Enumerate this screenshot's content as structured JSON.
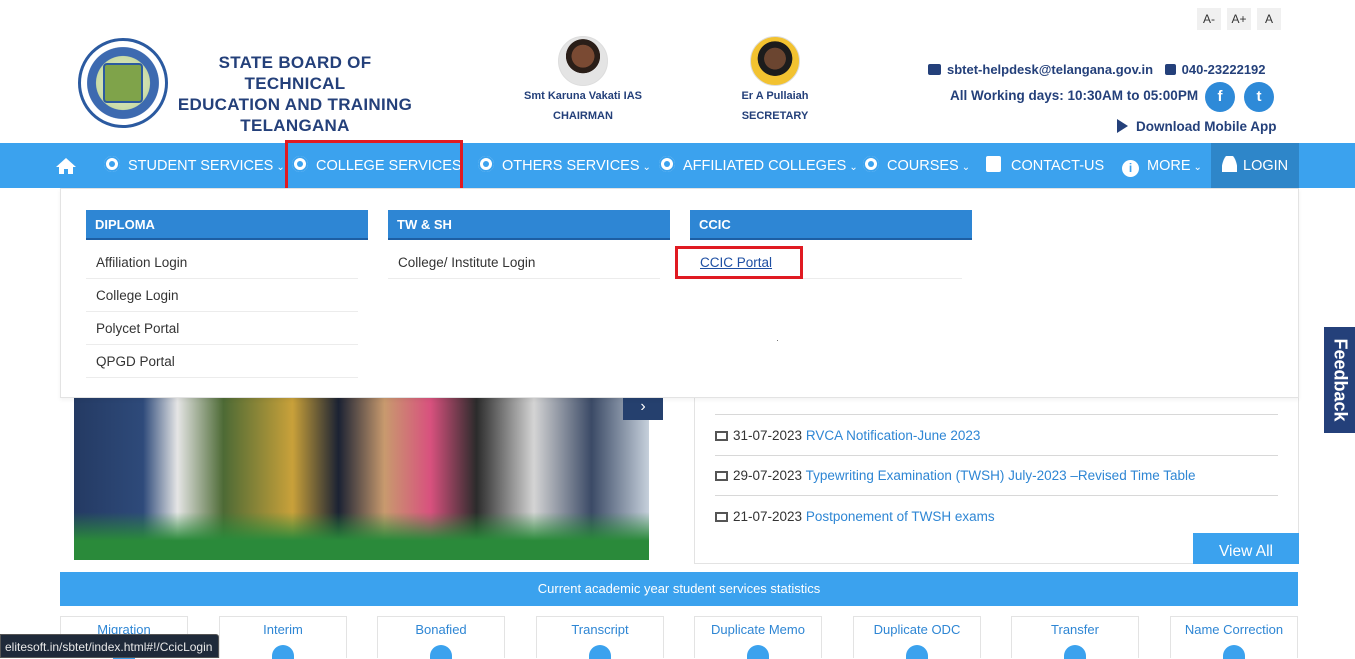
{
  "header": {
    "org_title_line1": "STATE BOARD OF TECHNICAL",
    "org_title_line2": "EDUCATION AND TRAINING",
    "org_title_line3": "TELANGANA",
    "people": [
      {
        "name": "Smt Karuna Vakati IAS",
        "role": "CHAIRMAN"
      },
      {
        "name": "Er A Pullaiah",
        "role": "SECRETARY"
      }
    ],
    "font_buttons": [
      "A-",
      "A+",
      "A"
    ],
    "email": "sbtet-helpdesk@telangana.gov.in",
    "phone": "040-23222192",
    "working_days": "All Working days: 10:30AM to 05:00PM",
    "social": [
      "f",
      "t"
    ],
    "download_app": "Download Mobile App"
  },
  "nav": {
    "items": [
      {
        "label": "STUDENT SERVICES",
        "icon": "gear-icon"
      },
      {
        "label": "COLLEGE SERVICES",
        "icon": "gear-icon"
      },
      {
        "label": "OTHERS SERVICES",
        "icon": "gear-icon"
      },
      {
        "label": "AFFILIATED COLLEGES",
        "icon": "gear-icon"
      },
      {
        "label": "COURSES",
        "icon": "gear-icon"
      },
      {
        "label": "CONTACT-US",
        "icon": "contact-icon"
      },
      {
        "label": "MORE",
        "icon": "info-icon"
      },
      {
        "label": "LOGIN",
        "icon": "user-icon"
      }
    ],
    "accent_color": "#3ba2ee"
  },
  "dropdown": {
    "columns": [
      {
        "title": "DIPLOMA",
        "links": [
          "Affiliation Login",
          "College Login",
          "Polycet Portal",
          "QPGD Portal"
        ]
      },
      {
        "title": "TW & SH",
        "links": [
          "College/ Institute Login"
        ]
      },
      {
        "title": "CCIC",
        "links": [
          "CCIC Portal"
        ]
      }
    ]
  },
  "news": [
    {
      "date": "31-07-2023",
      "title": "RVCA Notification-June 2023"
    },
    {
      "date": "29-07-2023",
      "title": "Typewriting Examination (TWSH) July-2023 –Revised Time Table"
    },
    {
      "date": "21-07-2023",
      "title": "Postponement of TWSH exams"
    }
  ],
  "view_all": "View All",
  "stats": {
    "title": "Current academic year student services statistics",
    "cards": [
      "Migration",
      "Interim",
      "Bonafied",
      "Transcript",
      "Duplicate Memo",
      "Duplicate ODC",
      "Transfer",
      "Name Correction"
    ]
  },
  "feedback": "Feedback",
  "status_url": "elitesoft.in/sbtet/index.html#!/CcicLogin"
}
